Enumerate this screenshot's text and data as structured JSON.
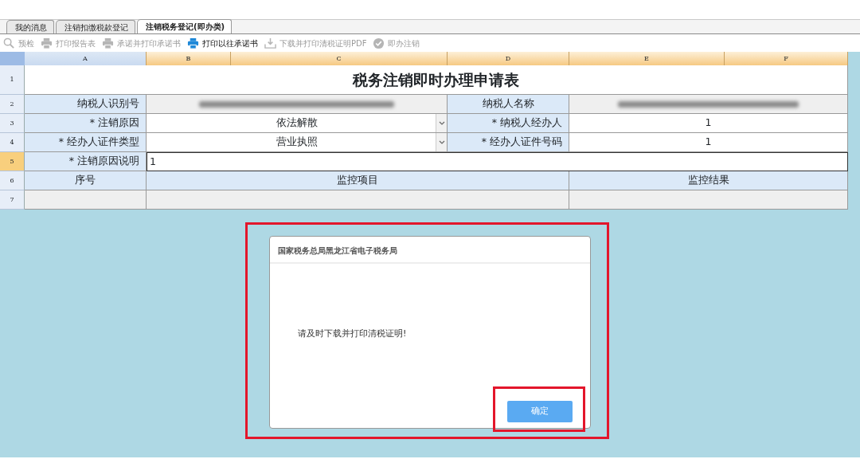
{
  "tabs": [
    {
      "label": "我的消息",
      "selected": false
    },
    {
      "label": "注销扣缴税款登记",
      "selected": false
    },
    {
      "label": "注销税务登记(即办类)",
      "selected": true
    }
  ],
  "toolbar": [
    {
      "kind": "search",
      "label": "预检",
      "disabled": true
    },
    {
      "kind": "print",
      "label": "打印报告表",
      "disabled": true
    },
    {
      "kind": "print",
      "label": "承诺并打印承诺书",
      "disabled": true
    },
    {
      "kind": "print",
      "label": "打印以往承诺书",
      "disabled": false
    },
    {
      "kind": "download",
      "label": "下载并打印清税证明PDF",
      "disabled": true
    },
    {
      "kind": "check",
      "label": "即办注销",
      "disabled": true
    }
  ],
  "column_letters": [
    {
      "label": "A",
      "selected": false
    },
    {
      "label": "B",
      "selected": true
    },
    {
      "label": "C",
      "selected": true
    },
    {
      "label": "D",
      "selected": true
    },
    {
      "label": "E",
      "selected": true
    },
    {
      "label": "F",
      "selected": true
    }
  ],
  "sheet": {
    "rows": [
      {
        "number": "1",
        "selected": false,
        "cells": [
          {
            "kind": "title",
            "text": "税务注销即时办理申请表"
          }
        ]
      },
      {
        "number": "2",
        "selected": false,
        "cells": [
          {
            "kind": "label",
            "text": "纳税人识别号"
          },
          {
            "kind": "redacted"
          },
          {
            "kind": "caption",
            "text": "纳税人名称"
          },
          {
            "kind": "redacted"
          }
        ]
      },
      {
        "number": "3",
        "selected": false,
        "cells": [
          {
            "kind": "label",
            "text": "* 注销原因"
          },
          {
            "kind": "select",
            "text": "依法解散"
          },
          {
            "kind": "label",
            "text": "* 纳税人经办人"
          },
          {
            "kind": "value",
            "text": "1"
          }
        ]
      },
      {
        "number": "4",
        "selected": false,
        "cells": [
          {
            "kind": "label",
            "text": "* 经办人证件类型"
          },
          {
            "kind": "select",
            "text": "营业执照"
          },
          {
            "kind": "label",
            "text": "* 经办人证件号码"
          },
          {
            "kind": "value",
            "text": "1"
          }
        ]
      },
      {
        "number": "5",
        "selected": true,
        "cells": [
          {
            "kind": "label",
            "text": "* 注销原因说明"
          },
          {
            "kind": "input",
            "text": "1"
          }
        ]
      }
    ]
  },
  "monitor": {
    "rows": [
      {
        "number": "6",
        "selected": false,
        "cells": [
          {
            "kind": "header",
            "text": "序号"
          },
          {
            "kind": "header",
            "text": "监控项目"
          },
          {
            "kind": "header",
            "text": "监控结果"
          }
        ]
      },
      {
        "number": "7",
        "selected": false,
        "cells": [
          {
            "kind": "empty"
          },
          {
            "kind": "empty"
          },
          {
            "kind": "empty"
          }
        ]
      }
    ]
  },
  "dialog": {
    "title": "国家税务总局黑龙江省电子税务局",
    "message": "请及时下载并打印清税证明!",
    "button": "确定"
  }
}
